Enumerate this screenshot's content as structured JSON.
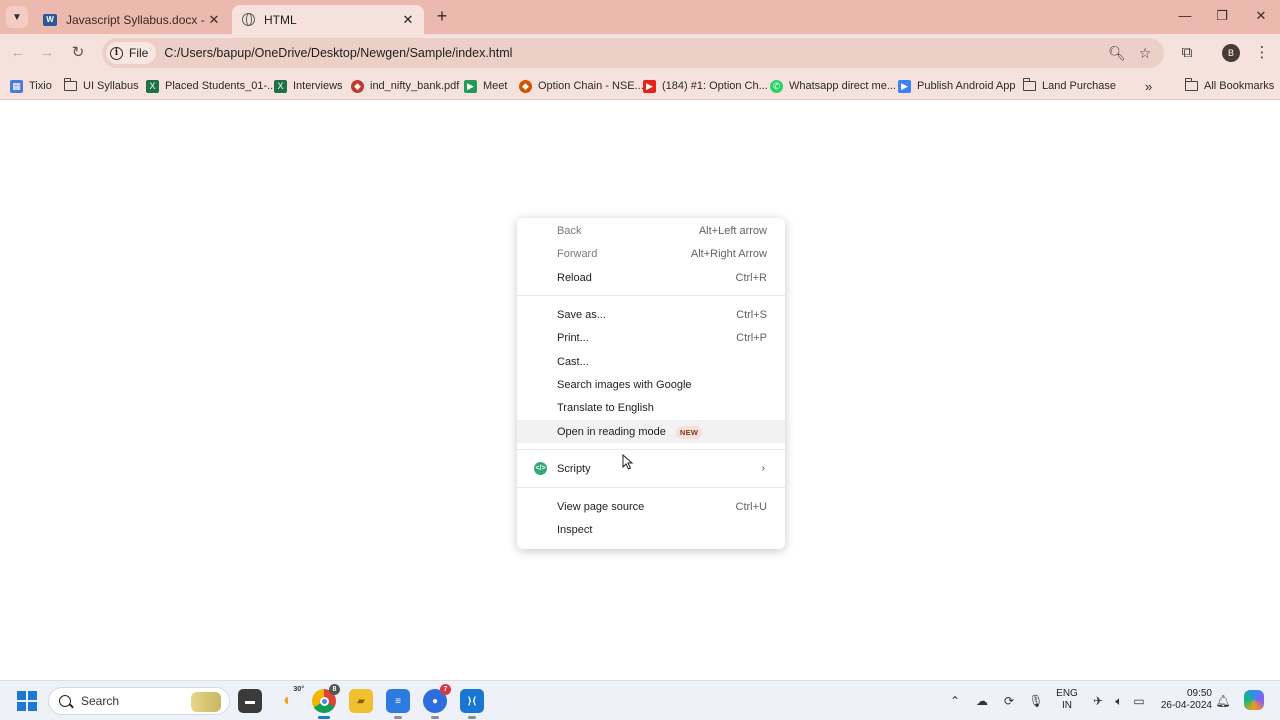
{
  "tabs": [
    {
      "title": "Javascript Syllabus.docx - Micro",
      "icon": "word-icon",
      "active": false
    },
    {
      "title": "HTML",
      "icon": "globe-icon",
      "active": true
    }
  ],
  "toolbar": {
    "chip_label": "File",
    "url": "C:/Users/bapup/OneDrive/Desktop/Newgen/Sample/index.html",
    "avatar_letter": "B"
  },
  "bookmarks": [
    {
      "label": "Tixio",
      "icon": "tixio-icon"
    },
    {
      "label": "UI Syllabus",
      "icon": "folder-icon"
    },
    {
      "label": "Placed Students_01-...",
      "icon": "excel-icon"
    },
    {
      "label": "Interviews",
      "icon": "excel-icon"
    },
    {
      "label": "ind_nifty_bank.pdf",
      "icon": "pdf-icon"
    },
    {
      "label": "Meet",
      "icon": "meet-icon"
    },
    {
      "label": "Option Chain - NSE...",
      "icon": "nse-icon"
    },
    {
      "label": "(184) #1: Option Ch...",
      "icon": "youtube-icon"
    },
    {
      "label": "Whatsapp direct me...",
      "icon": "whatsapp-icon"
    },
    {
      "label": "Publish Android App",
      "icon": "play-icon"
    },
    {
      "label": "Land Purchase",
      "icon": "folder-icon"
    }
  ],
  "all_bookmarks_label": "All Bookmarks",
  "context_menu": {
    "items": [
      {
        "label": "Back",
        "shortcut": "Alt+Left arrow",
        "disabled": true
      },
      {
        "label": "Forward",
        "shortcut": "Alt+Right Arrow",
        "disabled": true
      },
      {
        "label": "Reload",
        "shortcut": "Ctrl+R",
        "disabled": false
      },
      {
        "label": "Save as...",
        "shortcut": "Ctrl+S",
        "disabled": false
      },
      {
        "label": "Print...",
        "shortcut": "Ctrl+P",
        "disabled": false
      },
      {
        "label": "Cast...",
        "shortcut": "",
        "disabled": false
      },
      {
        "label": "Search images with Google",
        "shortcut": "",
        "disabled": false
      },
      {
        "label": "Translate to English",
        "shortcut": "",
        "disabled": false
      },
      {
        "label": "Open in reading mode",
        "shortcut": "",
        "badge": "NEW",
        "disabled": false
      },
      {
        "label": "Scripty",
        "shortcut": "",
        "disabled": false
      },
      {
        "label": "View page source",
        "shortcut": "Ctrl+U",
        "disabled": false
      },
      {
        "label": "Inspect",
        "shortcut": "",
        "disabled": false
      }
    ]
  },
  "taskbar": {
    "search_label": "Search",
    "weather_temp": "30°",
    "chrome_badge": "8",
    "zoom_badge": "7",
    "lang_line1": "ENG",
    "lang_line2": "IN",
    "time": "09:50",
    "date": "26-04-2024"
  }
}
